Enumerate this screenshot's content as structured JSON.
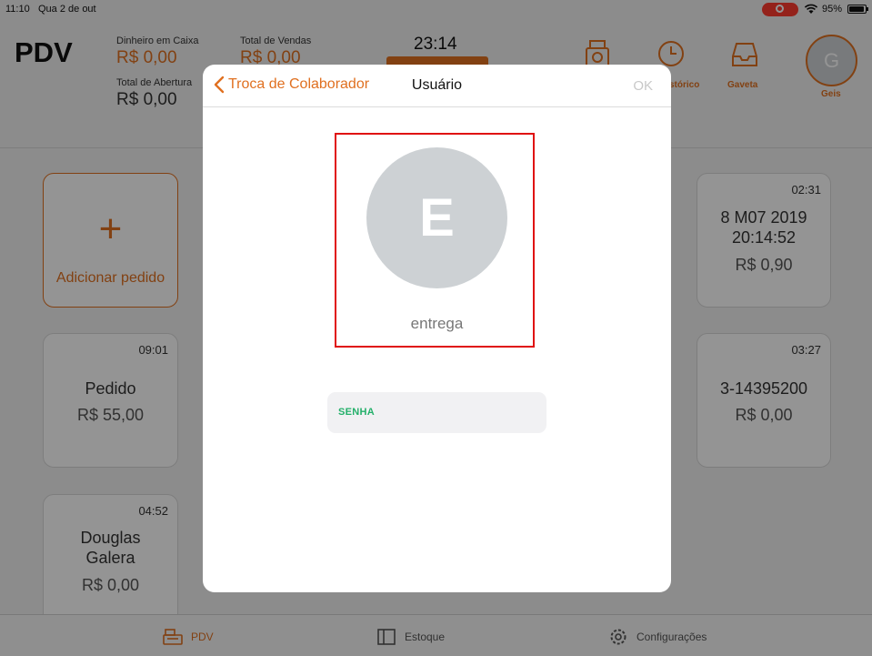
{
  "status_bar": {
    "time": "11:10",
    "date": "Qua 2 de out",
    "battery": "95%"
  },
  "header": {
    "title": "PDV",
    "cash_label": "Dinheiro em Caixa",
    "cash_value": "R$ 0,00",
    "sales_label": "Total de Vendas",
    "sales_value": "R$ 0,00",
    "opening_label": "Total de Abertura",
    "opening_value": "R$ 0,00",
    "clock": "23:14",
    "history_label": "Histórico",
    "drawer_label": "Gaveta",
    "user_initial": "G",
    "user_name": "Geis"
  },
  "cards": {
    "add_label": "Adicionar pedido",
    "add_symbol": "+",
    "items": [
      {
        "time": "09:01",
        "name": "Pedido",
        "price": "R$ 55,00"
      },
      {
        "time": "04:52",
        "name": "Douglas Galera",
        "price": "R$ 0,00"
      },
      {
        "time": "02:31",
        "name": "8 M07 2019 20:14:52",
        "price": "R$ 0,90"
      },
      {
        "time": "03:27",
        "name": "3-14395200",
        "price": "R$ 0,00"
      }
    ]
  },
  "tabbar": {
    "pdv": "PDV",
    "stock": "Estoque",
    "settings": "Configurações"
  },
  "modal": {
    "back_label": "Troca de Colaborador",
    "title": "Usuário",
    "ok_label": "OK",
    "avatar_initial": "E",
    "user_name": "entrega",
    "password_label": "SENHA",
    "password_value": ""
  },
  "colors": {
    "accent": "#e07020",
    "highlight": "#e01010",
    "password_label": "#24b06a"
  }
}
